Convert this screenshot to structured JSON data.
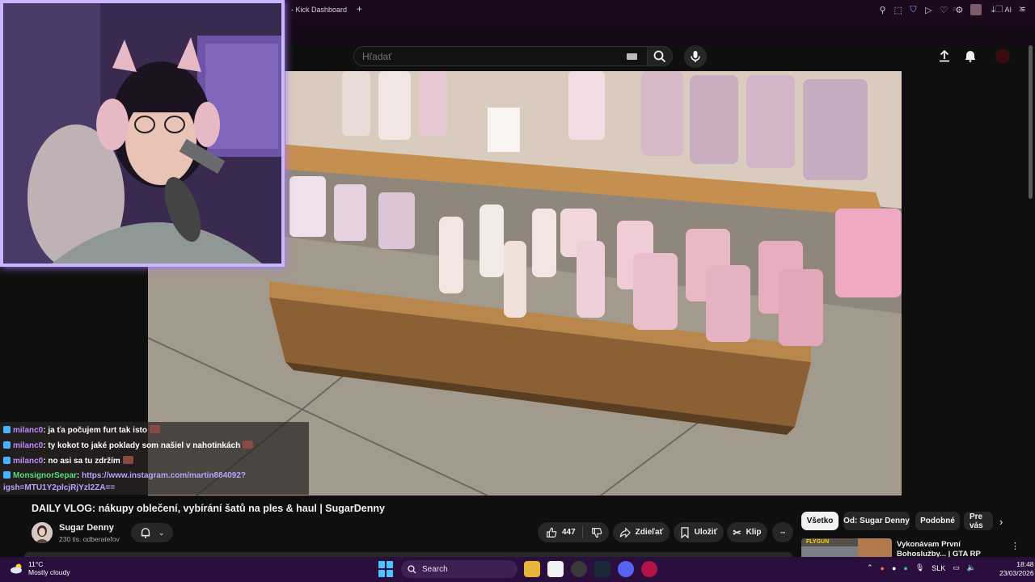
{
  "browser": {
    "tab_title": "- Kick Dashboard",
    "new_tab": "+",
    "extension_ai_label": "AI"
  },
  "youtube": {
    "search": {
      "placeholder": "Hľadať"
    },
    "video": {
      "title": "DAILY VLOG: nákupy oblečení, vybírání šatů na ples & haul | SugarDenny",
      "channel_name": "Sugar Denny",
      "subscribers": "230 tis. odberateľov",
      "like_count": "447",
      "share_label": "Zdieľať",
      "save_label": "Uložiť",
      "clip_label": "Klip",
      "more_label": "···"
    },
    "chips": [
      "Všetko",
      "Od: Sugar Denny",
      "Podobné",
      "Pre vás"
    ],
    "recommendation": {
      "title": "Vykonávam První Bohoslužby... | GTA RP",
      "thumb_label": "FLYGUN"
    }
  },
  "chat": {
    "messages": [
      {
        "user": "milanc0",
        "text": ": ja ťa počujem furt tak isto",
        "emote": true,
        "color": "#c18aff"
      },
      {
        "user": "milanc0",
        "text": ": ty kokot to jaké poklady som našiel v nahotinkách",
        "emote": true,
        "color": "#c18aff"
      },
      {
        "user": "milanc0",
        "text": ": no asi sa tu zdržím",
        "emote": true,
        "color": "#c18aff"
      },
      {
        "user": "MonsignorSepar",
        "text": ": ",
        "link": "https://www.instagram.com/martin884092?",
        "link2": "igsh=MTU1Y2plcjRjYzl2ZA==",
        "emote": false,
        "color": "#52e07a"
      }
    ]
  },
  "taskbar": {
    "weather_temp": "11°C",
    "weather_desc": "Mostly cloudy",
    "search_label": "Search",
    "language": "SLK",
    "time": "18:48",
    "date": "23/03/2026"
  },
  "colors": {
    "accent_purple": "#a67bff",
    "youtube_bg": "#0f0f0f",
    "taskbar_bg": "#2a0e3e"
  }
}
